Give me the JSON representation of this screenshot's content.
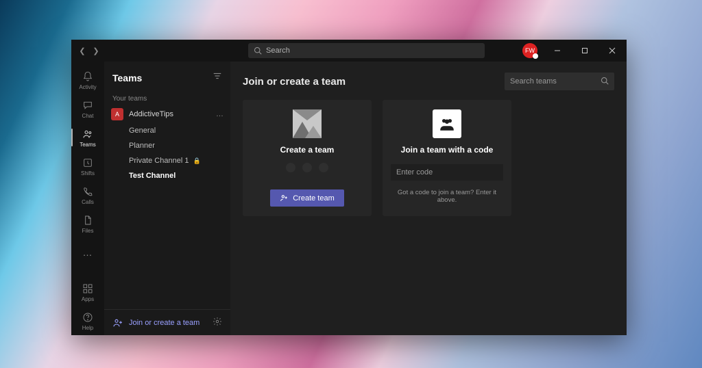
{
  "titlebar": {
    "search_placeholder": "Search",
    "avatar_initials": "FW"
  },
  "rail": {
    "items": [
      {
        "id": "activity",
        "label": "Activity"
      },
      {
        "id": "chat",
        "label": "Chat"
      },
      {
        "id": "teams",
        "label": "Teams"
      },
      {
        "id": "shifts",
        "label": "Shifts"
      },
      {
        "id": "calls",
        "label": "Calls"
      },
      {
        "id": "files",
        "label": "Files"
      }
    ],
    "apps_label": "Apps",
    "help_label": "Help"
  },
  "sidebar": {
    "title": "Teams",
    "section_label": "Your teams",
    "team": {
      "name": "AddictiveTips",
      "initial": "A"
    },
    "channels": [
      {
        "name": "General",
        "private": false,
        "active": false
      },
      {
        "name": "Planner",
        "private": false,
        "active": false
      },
      {
        "name": "Private Channel 1",
        "private": true,
        "active": false
      },
      {
        "name": "Test Channel",
        "private": false,
        "active": true
      }
    ],
    "footer_label": "Join or create a team"
  },
  "main": {
    "title": "Join or create a team",
    "search_placeholder": "Search teams",
    "create_card": {
      "title": "Create a team",
      "button_label": "Create team"
    },
    "join_card": {
      "title": "Join a team with a code",
      "input_placeholder": "Enter code",
      "hint": "Got a code to join a team? Enter it above."
    }
  }
}
